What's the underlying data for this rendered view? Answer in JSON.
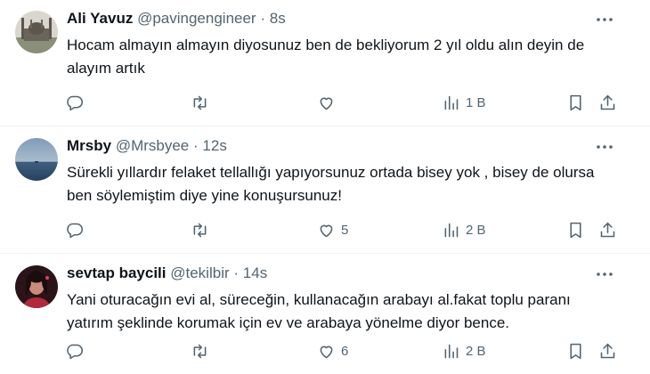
{
  "tweets": [
    {
      "name": "Ali Yavuz",
      "handle": "@pavingengineer",
      "dot": "·",
      "time": "8s",
      "text": "Hocam almayın almayın diyosunuz ben de bekliyorum 2 yıl oldu alın deyin de alayım artık",
      "likes": "",
      "views": "1 B",
      "avatar": "mosque-photo"
    },
    {
      "name": "Mrsby",
      "handle": "@Mrsbyee",
      "dot": "·",
      "time": "12s",
      "text": "Sürekli yıllardır felaket tellallığı yapıyorsunuz ortada bisey yok , bisey de olursa ben söylemiştim diye yine konuşursunuz!",
      "likes": "5",
      "views": "2 B",
      "avatar": "sea-photo"
    },
    {
      "name": "sevtap baycili",
      "handle": "@tekilbir",
      "dot": "·",
      "time": "14s",
      "text": "Yani oturacağın evi al, süreceğin, kullanacağın arabayı al.fakat toplu paranı yatırım şeklinde korumak için ev ve arabaya yönelme diyor bence.",
      "likes": "6",
      "views": "2 B",
      "avatar": "portrait-photo"
    }
  ],
  "icons": {
    "reply": "reply-icon",
    "retweet": "retweet-icon",
    "like": "like-icon",
    "views": "views-icon",
    "bookmark": "bookmark-icon",
    "share": "share-icon",
    "more": "more-icon"
  },
  "colors": {
    "text": "#0f1419",
    "secondary": "#536471",
    "divider": "#eff3f4"
  }
}
